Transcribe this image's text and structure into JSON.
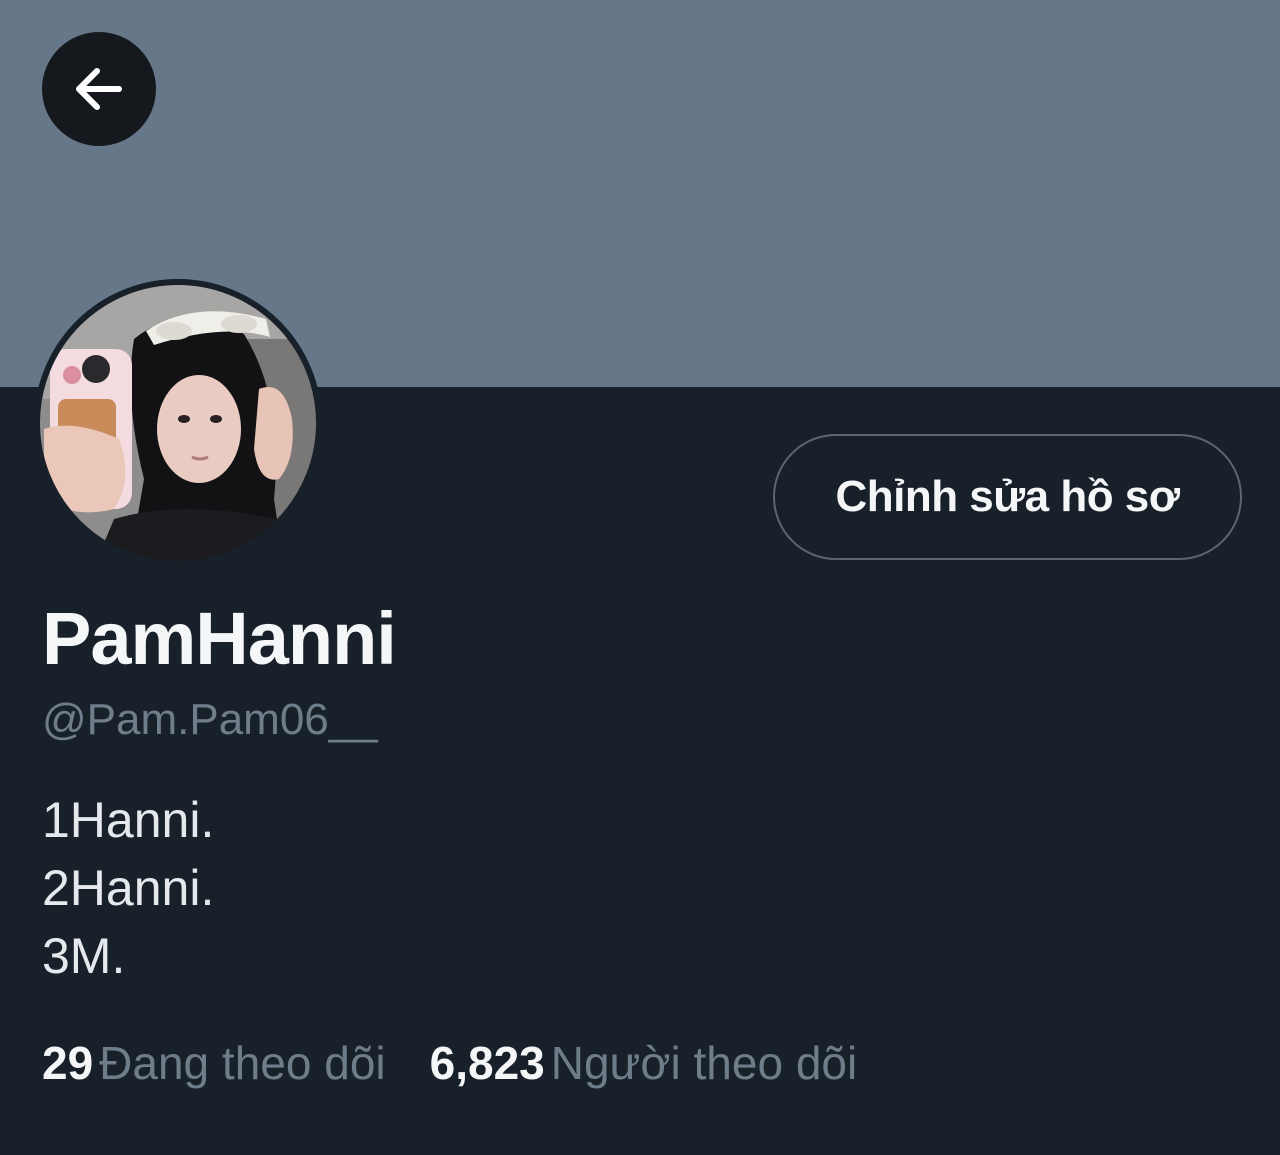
{
  "profile": {
    "display_name": "PamHanni",
    "handle": "@Pam.Pam06__",
    "bio_lines": [
      "1Hanni.",
      "2Hanni.",
      "3M."
    ],
    "edit_label": "Chỉnh sửa hồ sơ",
    "following_count": "29",
    "following_label": "Đang theo dõi",
    "followers_count": "6,823",
    "followers_label": "Người theo dõi"
  },
  "icons": {
    "back": "arrow-left-icon"
  },
  "colors": {
    "banner": "#657788",
    "background": "#18202a",
    "text_primary": "#f4f6f8",
    "text_secondary": "#6f7d8b",
    "button_border": "#5a6673"
  }
}
